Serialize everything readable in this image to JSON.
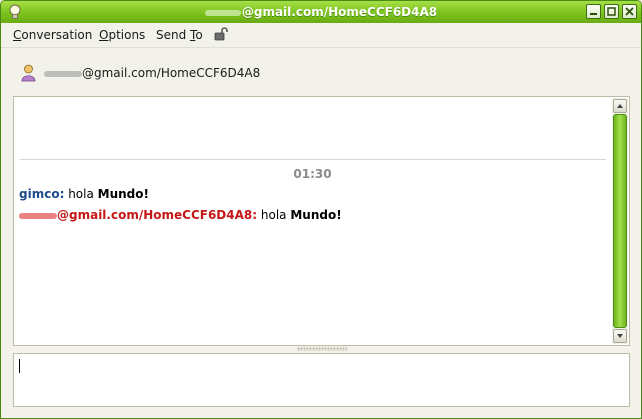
{
  "window": {
    "title_suffix": "@gmail.com/HomeCCF6D4A8",
    "controls": [
      "minimize",
      "maximize",
      "close"
    ]
  },
  "menu": {
    "conversation": {
      "accel": "C",
      "rest": "onversation"
    },
    "options": {
      "accel": "O",
      "rest": "ptions"
    },
    "send_to": {
      "pre": "Send ",
      "accel": "T",
      "rest": "o"
    }
  },
  "buddy": {
    "name_suffix": "@gmail.com/HomeCCF6D4A8",
    "icon": "buddy-status-icon"
  },
  "history": {
    "timestamp": "01:30",
    "messages": [
      {
        "sender": "gimco:",
        "text_plain": "hola ",
        "text_bold": "Mundo!"
      },
      {
        "sender_suffix": "@gmail.com/HomeCCF6D4A8:",
        "text_plain": "hola ",
        "text_bold": "Mundo!"
      }
    ]
  },
  "colors": {
    "titlebar": "#7cc21e",
    "self_name": "#1e4b8c",
    "other_name": "#c41616",
    "scroll_thumb": "#8fd23b"
  }
}
